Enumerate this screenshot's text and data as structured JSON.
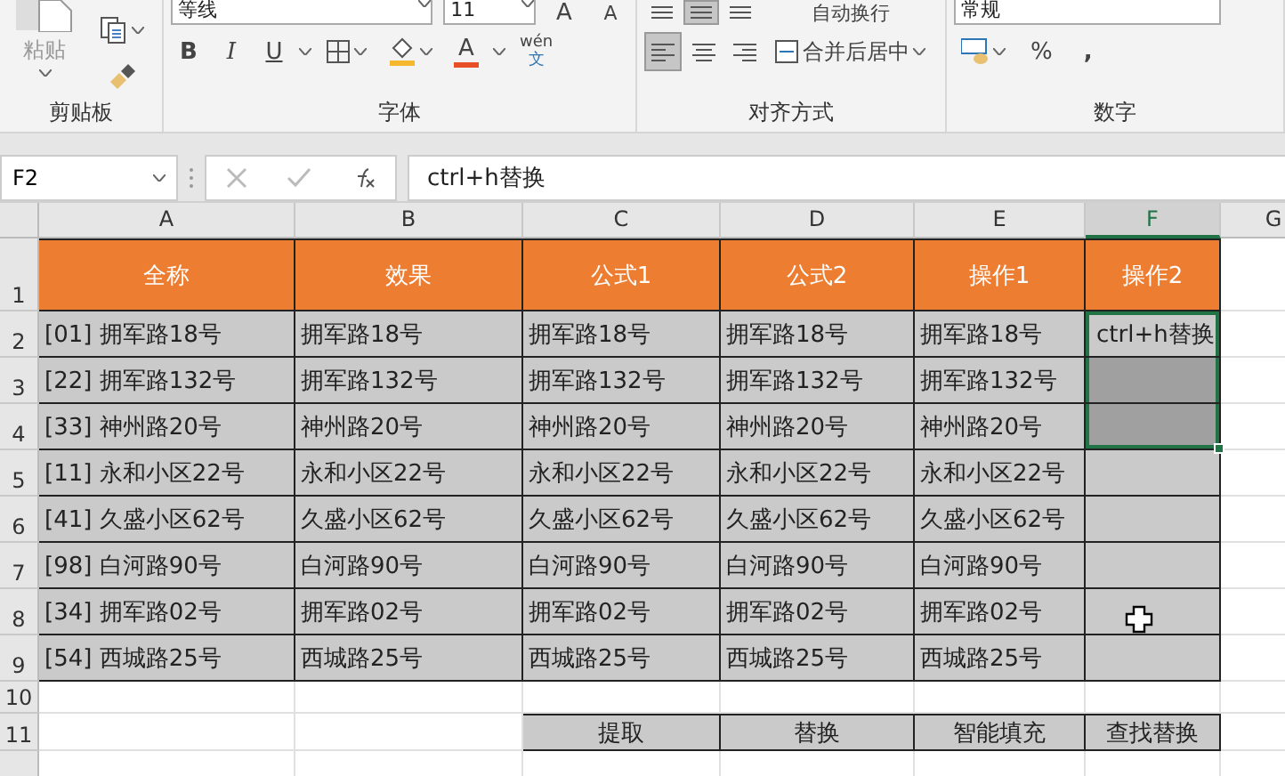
{
  "ribbon": {
    "clipboard": {
      "label": "剪贴板",
      "paste": "粘贴"
    },
    "font": {
      "label": "字体",
      "font_name": "等线",
      "font_size": "11",
      "grow": "A",
      "shrink": "A",
      "bold": "B",
      "italic": "I",
      "underline": "U",
      "font_color": "A",
      "phonetic_top": "wén",
      "phonetic_bottom": "文"
    },
    "alignment": {
      "label": "对齐方式",
      "wrap": "自动换行",
      "merge": "合并后居中",
      "vertical": [
        {
          "selected": false
        },
        {
          "selected": true
        },
        {
          "selected": false
        }
      ],
      "horizontal": [
        {
          "selected": true
        },
        {
          "selected": false
        },
        {
          "selected": false
        }
      ]
    },
    "number": {
      "label": "数字",
      "format": "常规",
      "percent": "%",
      "comma": ","
    }
  },
  "formula_bar": {
    "name_box": "F2",
    "formula": "ctrl+h替换"
  },
  "sheet": {
    "columns": [
      {
        "label": "A",
        "selected": false
      },
      {
        "label": "B",
        "selected": false
      },
      {
        "label": "C",
        "selected": false
      },
      {
        "label": "D",
        "selected": false
      },
      {
        "label": "E",
        "selected": false
      },
      {
        "label": "F",
        "selected": true
      },
      {
        "label": "G",
        "selected": false
      }
    ],
    "rows": [
      {
        "number": "1",
        "kind": "header",
        "cells": [
          {
            "text": "全称",
            "selected": false
          },
          {
            "text": "效果",
            "selected": false
          },
          {
            "text": "公式1",
            "selected": false
          },
          {
            "text": "公式2",
            "selected": false
          },
          {
            "text": "操作1",
            "selected": false
          },
          {
            "text": "操作2",
            "selected": false
          }
        ]
      },
      {
        "number": "2",
        "kind": "data",
        "cells": [
          {
            "text": "[01] 拥军路18号",
            "selected": false
          },
          {
            "text": "拥军路18号",
            "selected": false
          },
          {
            "text": "拥军路18号",
            "selected": false
          },
          {
            "text": "拥军路18号",
            "selected": false
          },
          {
            "text": "拥军路18号",
            "selected": false
          },
          {
            "text": "ctrl+h替换",
            "selected": true
          }
        ]
      },
      {
        "number": "3",
        "kind": "data",
        "cells": [
          {
            "text": "[22] 拥军路132号",
            "selected": false
          },
          {
            "text": "拥军路132号",
            "selected": false
          },
          {
            "text": "拥军路132号",
            "selected": false
          },
          {
            "text": "拥军路132号",
            "selected": false
          },
          {
            "text": "拥军路132号",
            "selected": false
          },
          {
            "selected": true
          }
        ]
      },
      {
        "number": "4",
        "kind": "data",
        "cells": [
          {
            "text": "[33] 神州路20号",
            "selected": false
          },
          {
            "text": "神州路20号",
            "selected": false
          },
          {
            "text": "神州路20号",
            "selected": false
          },
          {
            "text": "神州路20号",
            "selected": false
          },
          {
            "text": "神州路20号",
            "selected": false
          },
          {
            "selected": true
          }
        ]
      },
      {
        "number": "5",
        "kind": "data",
        "cells": [
          {
            "text": "[11] 永和小区22号",
            "selected": false
          },
          {
            "text": "永和小区22号",
            "selected": false
          },
          {
            "text": "永和小区22号",
            "selected": false
          },
          {
            "text": "永和小区22号",
            "selected": false
          },
          {
            "text": "永和小区22号",
            "selected": false
          },
          {
            "selected": false
          }
        ]
      },
      {
        "number": "6",
        "kind": "data",
        "cells": [
          {
            "text": "[41] 久盛小区62号",
            "selected": false
          },
          {
            "text": "久盛小区62号",
            "selected": false
          },
          {
            "text": "久盛小区62号",
            "selected": false
          },
          {
            "text": "久盛小区62号",
            "selected": false
          },
          {
            "text": "久盛小区62号",
            "selected": false
          },
          {
            "selected": false
          }
        ]
      },
      {
        "number": "7",
        "kind": "data",
        "cells": [
          {
            "text": "[98] 白河路90号",
            "selected": false
          },
          {
            "text": "白河路90号",
            "selected": false
          },
          {
            "text": "白河路90号",
            "selected": false
          },
          {
            "text": "白河路90号",
            "selected": false
          },
          {
            "text": "白河路90号",
            "selected": false
          },
          {
            "selected": false
          }
        ]
      },
      {
        "number": "8",
        "kind": "data",
        "cells": [
          {
            "text": "[34] 拥军路02号",
            "selected": false
          },
          {
            "text": "拥军路02号",
            "selected": false
          },
          {
            "text": "拥军路02号",
            "selected": false
          },
          {
            "text": "拥军路02号",
            "selected": false
          },
          {
            "text": "拥军路02号",
            "selected": false
          },
          {
            "selected": false
          }
        ]
      },
      {
        "number": "9",
        "kind": "data",
        "cells": [
          {
            "text": "[54] 西城路25号",
            "selected": false
          },
          {
            "text": "西城路25号",
            "selected": false
          },
          {
            "text": "西城路25号",
            "selected": false
          },
          {
            "text": "西城路25号",
            "selected": false
          },
          {
            "text": "西城路25号",
            "selected": false
          },
          {
            "selected": false
          }
        ]
      },
      {
        "number": "10",
        "kind": "blank",
        "cells": []
      },
      {
        "number": "11",
        "kind": "footer",
        "cells": [
          {
            "selected": false
          },
          {
            "selected": false
          },
          {
            "text": "提取",
            "selected": false
          },
          {
            "text": "替换",
            "selected": false
          },
          {
            "text": "智能填充",
            "selected": false
          },
          {
            "text": "查找替换",
            "selected": false
          }
        ]
      }
    ]
  }
}
